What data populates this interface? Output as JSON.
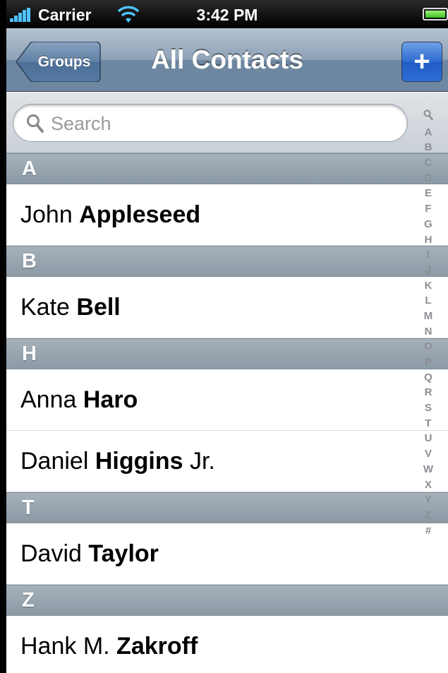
{
  "status_bar": {
    "carrier": "Carrier",
    "time": "3:42 PM",
    "signal_icon": "signal-bars-icon",
    "wifi_icon": "wifi-icon",
    "battery_icon": "battery-icon",
    "battery_level": 1.0
  },
  "nav_bar": {
    "back_label": "Groups",
    "title": "All Contacts",
    "add_label": "+"
  },
  "search": {
    "placeholder": "Search",
    "icon": "search-icon"
  },
  "sections": [
    {
      "letter": "A",
      "contacts": [
        {
          "first": "John",
          "last": "Appleseed",
          "suffix": ""
        }
      ]
    },
    {
      "letter": "B",
      "contacts": [
        {
          "first": "Kate",
          "last": "Bell",
          "suffix": ""
        }
      ]
    },
    {
      "letter": "H",
      "contacts": [
        {
          "first": "Anna",
          "last": "Haro",
          "suffix": ""
        },
        {
          "first": "Daniel",
          "last": "Higgins",
          "suffix": "Jr."
        }
      ]
    },
    {
      "letter": "T",
      "contacts": [
        {
          "first": "David",
          "last": "Taylor",
          "suffix": ""
        }
      ]
    },
    {
      "letter": "Z",
      "contacts": [
        {
          "first": "Hank M.",
          "last": "Zakroff",
          "suffix": ""
        }
      ]
    }
  ],
  "index": [
    "Q",
    "A",
    "B",
    "C",
    "D",
    "E",
    "F",
    "G",
    "H",
    "I",
    "J",
    "K",
    "L",
    "M",
    "N",
    "O",
    "P",
    "Q",
    "R",
    "S",
    "T",
    "U",
    "V",
    "W",
    "X",
    "Y",
    "Z",
    "#"
  ],
  "colors": {
    "nav_bar": "#6d87a1",
    "add_button": "#2e6bd1",
    "section_header": "#98a5b0",
    "index_text": "#8b8e92"
  }
}
